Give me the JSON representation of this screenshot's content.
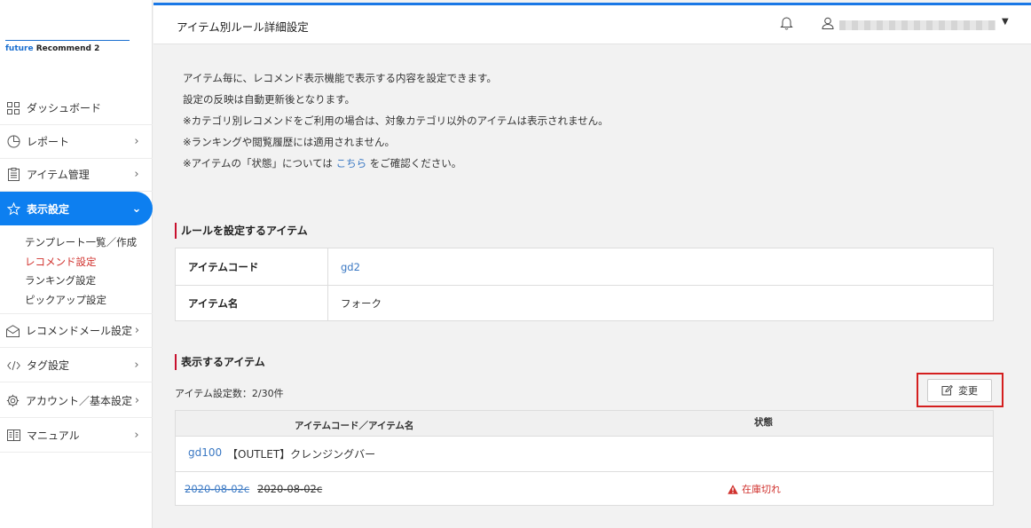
{
  "sidebar": {
    "logo_brand": "future",
    "logo_rest": " Recommend 2",
    "items": [
      {
        "label": "ダッシュボード",
        "icon": "dashboard-icon"
      },
      {
        "label": "レポート",
        "icon": "pie-chart-icon"
      },
      {
        "label": "アイテム管理",
        "icon": "clipboard-icon"
      },
      {
        "label": "表示設定",
        "icon": "star-icon"
      },
      {
        "label": "レコメンドメール設定",
        "icon": "mail-icon"
      },
      {
        "label": "タグ設定",
        "icon": "code-icon"
      },
      {
        "label": "アカウント／基本設定",
        "icon": "gear-icon"
      },
      {
        "label": "マニュアル",
        "icon": "book-icon"
      }
    ],
    "sub_items": [
      "テンプレート一覧／作成",
      "レコメンド設定",
      "ランキング設定",
      "ピックアップ設定"
    ]
  },
  "header": {
    "title": "アイテム別ルール詳細設定"
  },
  "intro": {
    "line1": "アイテム毎に、レコメンド表示機能で表示する内容を設定できます。",
    "line2": "設定の反映は自動更新後となります。",
    "line3": "※カテゴリ別レコメンドをご利用の場合は、対象カテゴリ以外のアイテムは表示されません。",
    "line4": "※ランキングや閲覧履歴には適用されません。",
    "line5_prefix": "※アイテムの「状態」については",
    "line5_link": "こちら",
    "line5_suffix": "をご確認ください。"
  },
  "rule_section": {
    "heading": "ルールを設定するアイテム",
    "code_label": "アイテムコード",
    "code_value": "gd2",
    "name_label": "アイテム名",
    "name_value": "フォーク"
  },
  "display_section": {
    "heading": "表示するアイテム",
    "count": "アイテム設定数：2/30件",
    "change_button": "変更",
    "col_code_name": "アイテムコード／アイテム名",
    "col_status": "状態",
    "rows": [
      {
        "code": "gd100",
        "name": "【OUTLET】クレンジングバー",
        "status": ""
      },
      {
        "code": "2020-08-02c",
        "name": "2020-08-02c",
        "status": "在庫切れ"
      }
    ]
  },
  "colors": {
    "accent": "#0d7ff0",
    "link": "#3a78c3",
    "alert": "#d0312d",
    "highlight": "#d41f1f"
  }
}
